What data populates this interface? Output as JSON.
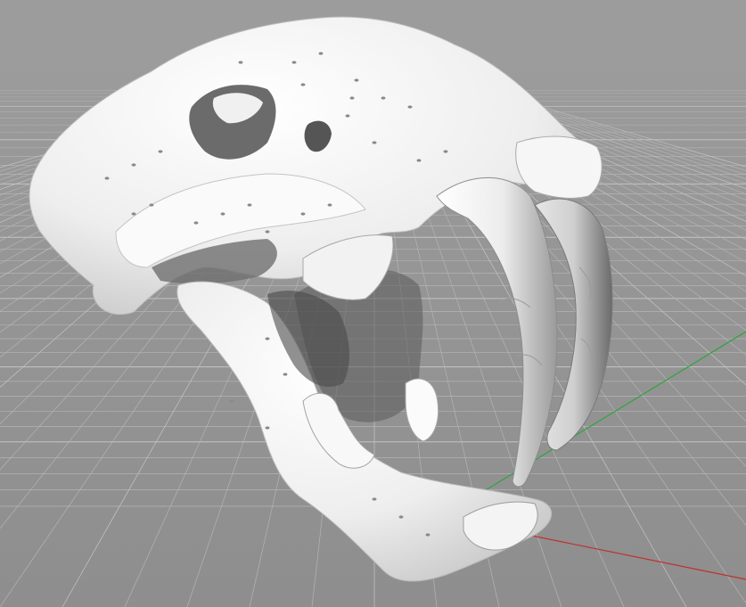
{
  "viewport": {
    "background_top": "#9c9c9c",
    "background_bottom": "#8e8e8e",
    "grid_color": "#b4b4b4",
    "grid_major_color": "#c4c4c4",
    "axis_x_color": "#c0302c",
    "axis_y_color": "#2ea43a"
  },
  "model": {
    "name": "saber-tooth-skull",
    "surface_color": "#f4f4f4",
    "shade_color": "#3a3a3a"
  }
}
